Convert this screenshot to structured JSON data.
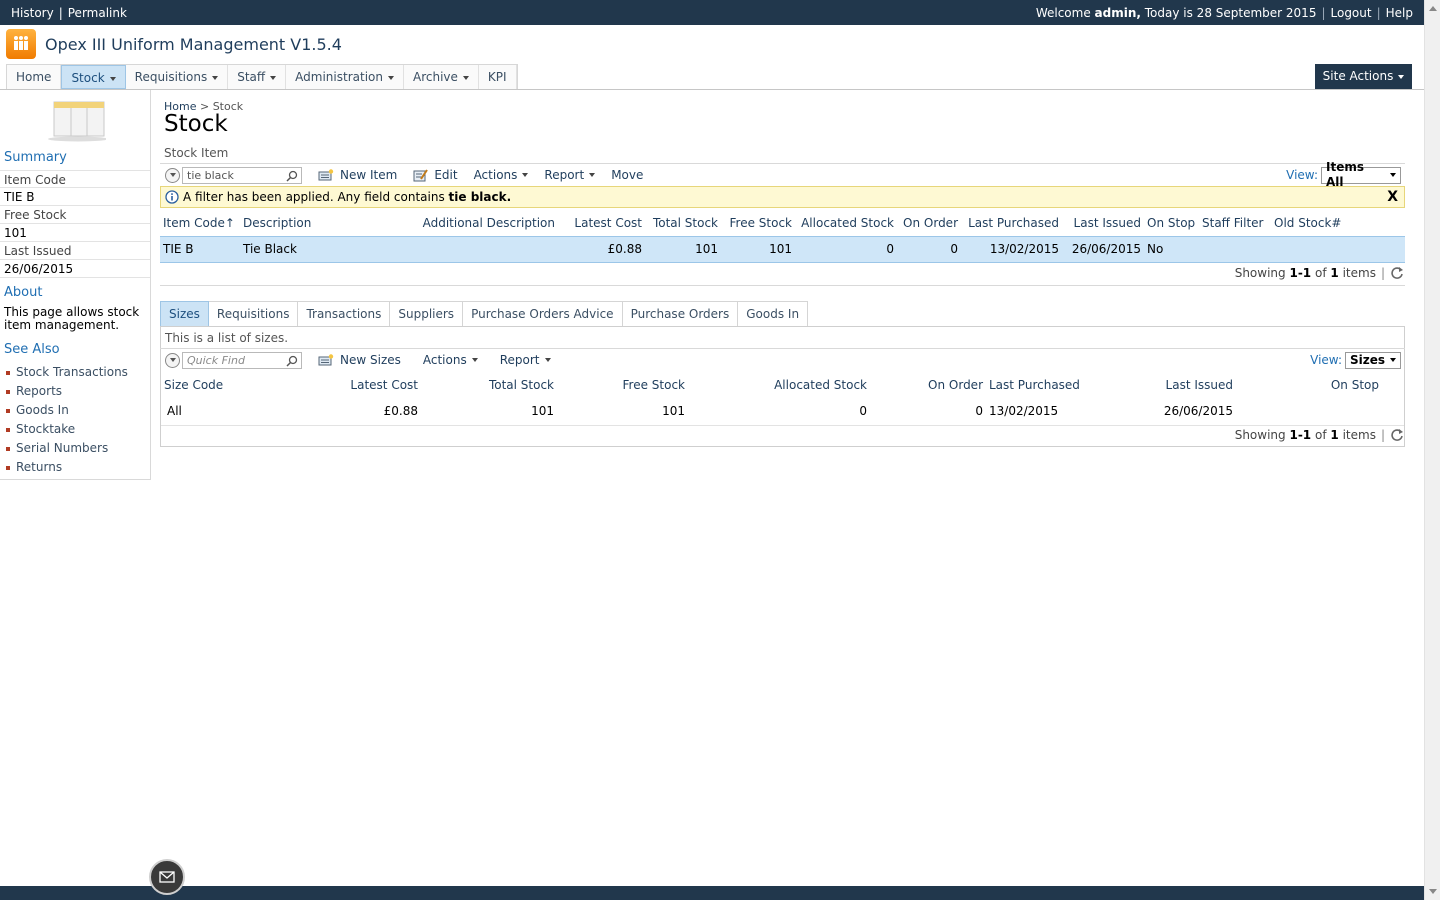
{
  "topbar": {
    "history": "History",
    "permalink": "Permalink",
    "welcome_prefix": "Welcome",
    "user": "admin,",
    "today": "Today is 28 September 2015",
    "logout": "Logout",
    "help": "Help"
  },
  "app": {
    "title": "Opex III Uniform Management V1.5.4"
  },
  "nav": {
    "home": "Home",
    "stock": "Stock",
    "requisitions": "Requisitions",
    "staff": "Staff",
    "administration": "Administration",
    "archive": "Archive",
    "kpi": "KPI",
    "site_actions": "Site Actions"
  },
  "sidebar": {
    "summary": "Summary",
    "item_code_label": "Item Code",
    "item_code_value": "TIE B",
    "free_stock_label": "Free Stock",
    "free_stock_value": "101",
    "last_issued_label": "Last Issued",
    "last_issued_value": "26/06/2015",
    "about": "About",
    "about_text": "This page allows stock item management.",
    "see_also": "See Also",
    "links": [
      "Stock Transactions",
      "Reports",
      "Goods In",
      "Stocktake",
      "Serial Numbers",
      "Returns"
    ]
  },
  "breadcrumb": {
    "home": "Home",
    "sep": ">",
    "current": "Stock"
  },
  "page": {
    "title": "Stock",
    "subtitle": "Stock Item"
  },
  "toolbar1": {
    "search_value": "tie black",
    "new_item": "New Item",
    "edit": "Edit",
    "actions": "Actions",
    "report": "Report",
    "move": "Move",
    "view_label": "View:",
    "view_value": "Items All"
  },
  "filter": {
    "prefix": "A filter has been applied. Any field contains",
    "term": "tie black.",
    "close": "X"
  },
  "items_table": {
    "headers": [
      "Item Code",
      "Description",
      "Additional Description",
      "Latest Cost",
      "Total Stock",
      "Free Stock",
      "Allocated Stock",
      "On Order",
      "Last Purchased",
      "Last Issued",
      "On Stop",
      "Staff Filter",
      "Old Stock#"
    ],
    "sort_arrow": "↑",
    "rows": [
      [
        "TIE B",
        "Tie Black",
        "",
        "£0.88",
        "101",
        "101",
        "0",
        "0",
        "13/02/2015",
        "26/06/2015",
        "No",
        "",
        ""
      ]
    ]
  },
  "paging1": {
    "showing": "Showing",
    "range": "1-1",
    "of": "of",
    "total": "1",
    "items": "items"
  },
  "tabs": [
    "Sizes",
    "Requisitions",
    "Transactions",
    "Suppliers",
    "Purchase Orders Advice",
    "Purchase Orders",
    "Goods In"
  ],
  "sizes": {
    "description": "This is a list of sizes.",
    "quick_find_placeholder": "Quick Find",
    "new_sizes": "New Sizes",
    "actions": "Actions",
    "report": "Report",
    "view_label": "View:",
    "view_value": "Sizes",
    "headers": [
      "Size Code",
      "Latest Cost",
      "Total Stock",
      "Free Stock",
      "Allocated Stock",
      "On Order",
      "Last Purchased",
      "Last Issued",
      "On Stop"
    ],
    "rows": [
      [
        "All",
        "£0.88",
        "101",
        "101",
        "0",
        "0",
        "13/02/2015",
        "26/06/2015",
        ""
      ]
    ]
  },
  "paging2": {
    "showing": "Showing",
    "range": "1-1",
    "of": "of",
    "total": "1",
    "items": "items"
  },
  "colors": {
    "dark_bar": "#21374c",
    "link": "#1f6eb2",
    "selected_row": "#cfe6f8",
    "accent_orange": "#f07b00"
  }
}
